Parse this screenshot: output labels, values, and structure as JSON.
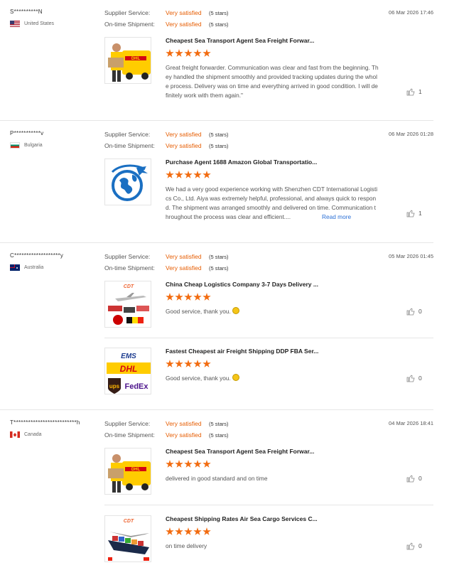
{
  "labels": {
    "supplier_service": "Supplier Service:",
    "on_time_shipment": "On-time Shipment:",
    "read_more": "Read more"
  },
  "reviews": [
    {
      "user": "S**********N",
      "country": "United States",
      "flag": "us",
      "date": "06 Mar 2026 17:46",
      "supplier_rating": "Very satisfied",
      "supplier_stars": "(5 stars)",
      "shipment_rating": "Very satisfied",
      "shipment_stars": "(5 stars)",
      "products": [
        {
          "title": "Cheapest Sea Transport Agent Sea Freight Forwar...",
          "stars": 5,
          "thumb": "dhl-courier",
          "text": "Great freight forwarder. Communication was clear and fast from the beginning. They handled the shipment smoothly and provided tracking updates during the whole process. Delivery was on time and everything arrived in good condition. I will definitely work with them again.\"",
          "likes": "1"
        }
      ]
    },
    {
      "user": "P***********v",
      "country": "Bulgaria",
      "flag": "bg",
      "date": "06 Mar 2026 01:28",
      "supplier_rating": "Very satisfied",
      "supplier_stars": "(5 stars)",
      "shipment_rating": "Very satisfied",
      "shipment_stars": "(5 stars)",
      "products": [
        {
          "title": "Purchase Agent 1688 Amazon Global Transportatio...",
          "stars": 5,
          "thumb": "globe-plane",
          "text": "We had a very good experience working with Shenzhen CDT International Logistics Co., Ltd. Aiya was extremely helpful, professional, and always quick to respond. The shipment was arranged smoothly and delivered on time. Communication throughout the process was clear and efficient....",
          "likes": "1",
          "read_more": true
        }
      ]
    },
    {
      "user": "C*******************y",
      "country": "Australia",
      "flag": "au",
      "date": "05 Mar 2026 01:45",
      "supplier_rating": "Very satisfied",
      "supplier_stars": "(5 stars)",
      "shipment_rating": "Very satisfied",
      "shipment_stars": "(5 stars)",
      "products": [
        {
          "title": "China Cheap Logistics Company 3-7 Days Delivery ...",
          "stars": 5,
          "thumb": "cdt-plane",
          "text": "Good service, thank you.",
          "emoji": true,
          "likes": "0"
        },
        {
          "title": "Fastest Cheapest air Freight Shipping DDP FBA Ser...",
          "stars": 5,
          "thumb": "carriers",
          "text": "Good service, thank you.",
          "emoji": true,
          "likes": "0"
        }
      ]
    },
    {
      "user": "T**************************h",
      "country": "Canada",
      "flag": "ca",
      "date": "04 Mar 2026 18:41",
      "supplier_rating": "Very satisfied",
      "supplier_stars": "(5 stars)",
      "shipment_rating": "Very satisfied",
      "shipment_stars": "(5 stars)",
      "products": [
        {
          "title": "Cheapest Sea Transport Agent Sea Freight Forwar...",
          "stars": 5,
          "thumb": "dhl-courier",
          "text": "delivered in good standard and on time",
          "likes": "0"
        },
        {
          "title": "Cheapest Shipping Rates Air Sea Cargo Services C...",
          "stars": 5,
          "thumb": "cargo-ship",
          "text": "on time delivery",
          "likes": "0"
        }
      ]
    }
  ],
  "thumb_logos": {
    "dhl": "DHL",
    "ems": "EMS",
    "ups": "ups",
    "fedex": "FedEx",
    "cdt": "CDT"
  }
}
